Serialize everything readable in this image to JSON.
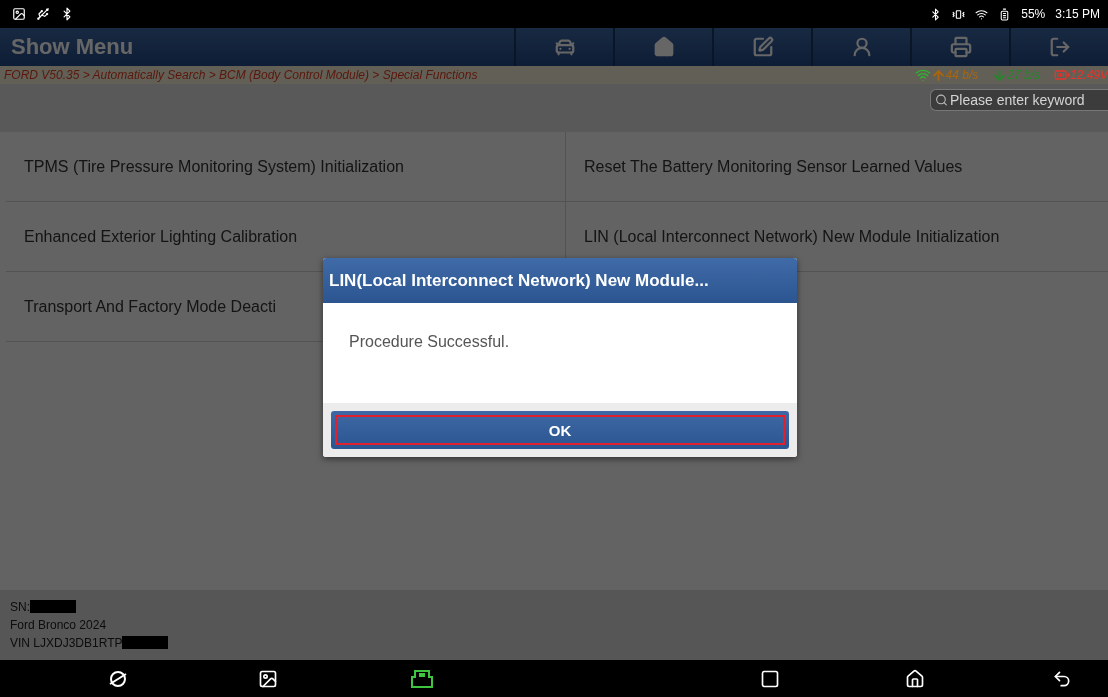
{
  "status_bar": {
    "battery": "55%",
    "time": "3:15 PM"
  },
  "header": {
    "title": "Show Menu",
    "tools": [
      {
        "kind": "diagnose"
      },
      {
        "kind": "home"
      },
      {
        "kind": "edit"
      },
      {
        "kind": "support"
      },
      {
        "kind": "print"
      },
      {
        "kind": "exit"
      }
    ]
  },
  "breadcrumb": "FORD V50.35 > Automatically Search > BCM (Body Control Module) > Special Functions",
  "stats": [
    {
      "kind": "upload",
      "text": "44 b/s",
      "color": "#a8650f"
    },
    {
      "kind": "download",
      "text": "27 b/s",
      "color": "#23862a"
    },
    {
      "kind": "battery",
      "text": "12.49V",
      "color": "#e5342c"
    }
  ],
  "search": {
    "placeholder": "Please enter keyword"
  },
  "functions": [
    {
      "label": "TPMS (Tire Pressure Monitoring System) Initialization"
    },
    {
      "label": "Reset The Battery Monitoring Sensor Learned Values"
    },
    {
      "label": "Enhanced Exterior Lighting Calibration"
    },
    {
      "label": "LIN (Local Interconnect Network) New Module Initialization"
    },
    {
      "label": "Transport And Factory Mode Deacti"
    }
  ],
  "vehicle_info": [
    {
      "text": "SN:",
      "redacted": true
    },
    {
      "text": "Ford Bronco 2024",
      "redacted": false
    },
    {
      "text": "VIN LJXDJ3DB1RTP",
      "redacted": true
    }
  ],
  "dialog": {
    "title": "LIN(Local Interconnect Network) New Module...",
    "message": "Procedure Successful.",
    "button": {
      "label": "OK",
      "focused": true
    }
  },
  "nav_bar": [
    {
      "kind": "browser"
    },
    {
      "kind": "gallery"
    },
    {
      "kind": "vci"
    },
    {
      "kind": "recents"
    },
    {
      "kind": "home"
    },
    {
      "kind": "back"
    }
  ]
}
